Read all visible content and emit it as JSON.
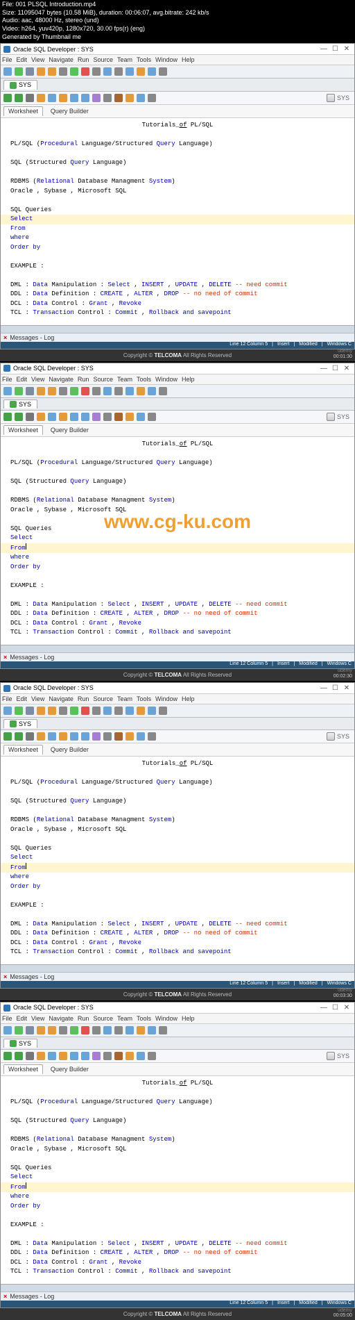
{
  "meta": {
    "file_line": "File: 001 PLSQL Introduction.mp4",
    "size_line": "Size: 11095047 bytes (10.58 MiB), duration: 00:06:07, avg.bitrate: 242 kb/s",
    "audio_line": "Audio: aac, 48000 Hz, stereo (und)",
    "video_line": "Video: h264, yuv420p, 1280x720, 30.00 fps(r) (eng)",
    "gen_line": "Generated by Thumbnail me"
  },
  "window": {
    "title": "Oracle SQL Developer : SYS",
    "menu": [
      "File",
      "Edit",
      "View",
      "Navigate",
      "Run",
      "Source",
      "Team",
      "Tools",
      "Window",
      "Help"
    ],
    "tab_label": "SYS",
    "caption_right": "SYS",
    "ws_tabs": [
      "Worksheet",
      "Query Builder"
    ]
  },
  "code": {
    "title_pre": "Tutorials_",
    "title_u": "of",
    "title_post": " PL/SQL",
    "l_plsql_pre": "PL/SQL (",
    "l_plsql_k1": "Procedural",
    "l_plsql_mid1": " Language/Structured ",
    "l_plsql_k2": "Query",
    "l_plsql_mid2": " Language)",
    "l_sql_pre": "SQL (Structured ",
    "l_sql_k": "Query",
    "l_sql_post": " Language)",
    "l_rdbms_pre": "RDBMS (",
    "l_rdbms_k1": "Relational",
    "l_rdbms_mid": " Database Managment ",
    "l_rdbms_k2": "System",
    "l_rdbms_post": ")",
    "l_vendors": "Oracle , Sybase , Microsoft SQL",
    "l_sqlq": "SQL Queries",
    "l_select": "Select",
    "l_from": "From",
    "l_where": "where",
    "l_orderby": "Order by",
    "l_example": "EXAMPLE :",
    "dml_pre": "DML : ",
    "dml_k": "Data",
    "dml_post": " Manipulation :   ",
    "dml_1": "Select",
    "dml_c": " , ",
    "dml_2": "INSERT",
    "dml_3": "UPDATE",
    "dml_4": "DELETE",
    "dml_cmt": " -- need commit",
    "ddl_pre": "DDL : ",
    "ddl_k": "Data",
    "ddl_post": " Definition   :   ",
    "ddl_1": "CREATE",
    "ddl_2": "ALTER",
    "ddl_3": "DROP",
    "ddl_cmt": " -- no need of commit",
    "dcl_pre": "DCL : ",
    "dcl_k": "Data",
    "dcl_post": " Control      :   ",
    "dcl_1": "Grant",
    "dcl_2": "Revoke",
    "tcl_pre": "TCL : ",
    "tcl_k": "Transaction",
    "tcl_post": " Control :  ",
    "tcl_1": "Commit",
    "tcl_2": "Rollback",
    "tcl_3": "and",
    "tcl_4": "savepoint"
  },
  "status": {
    "messages": "Messages - Log",
    "right1": "Line 12 Column 5",
    "right2": "Insert",
    "right3": "Modified",
    "right4": "Windows C"
  },
  "footer": {
    "copy_pre": "Copyright © ",
    "brand": "TELCOMA",
    "copy_post": " All Rights Reserved",
    "udemy": "udemy"
  },
  "watermark": "www.cg-ku.com",
  "timestamps": [
    "00:01:30",
    "00:02:30",
    "00:03:30",
    "00:05:00"
  ]
}
